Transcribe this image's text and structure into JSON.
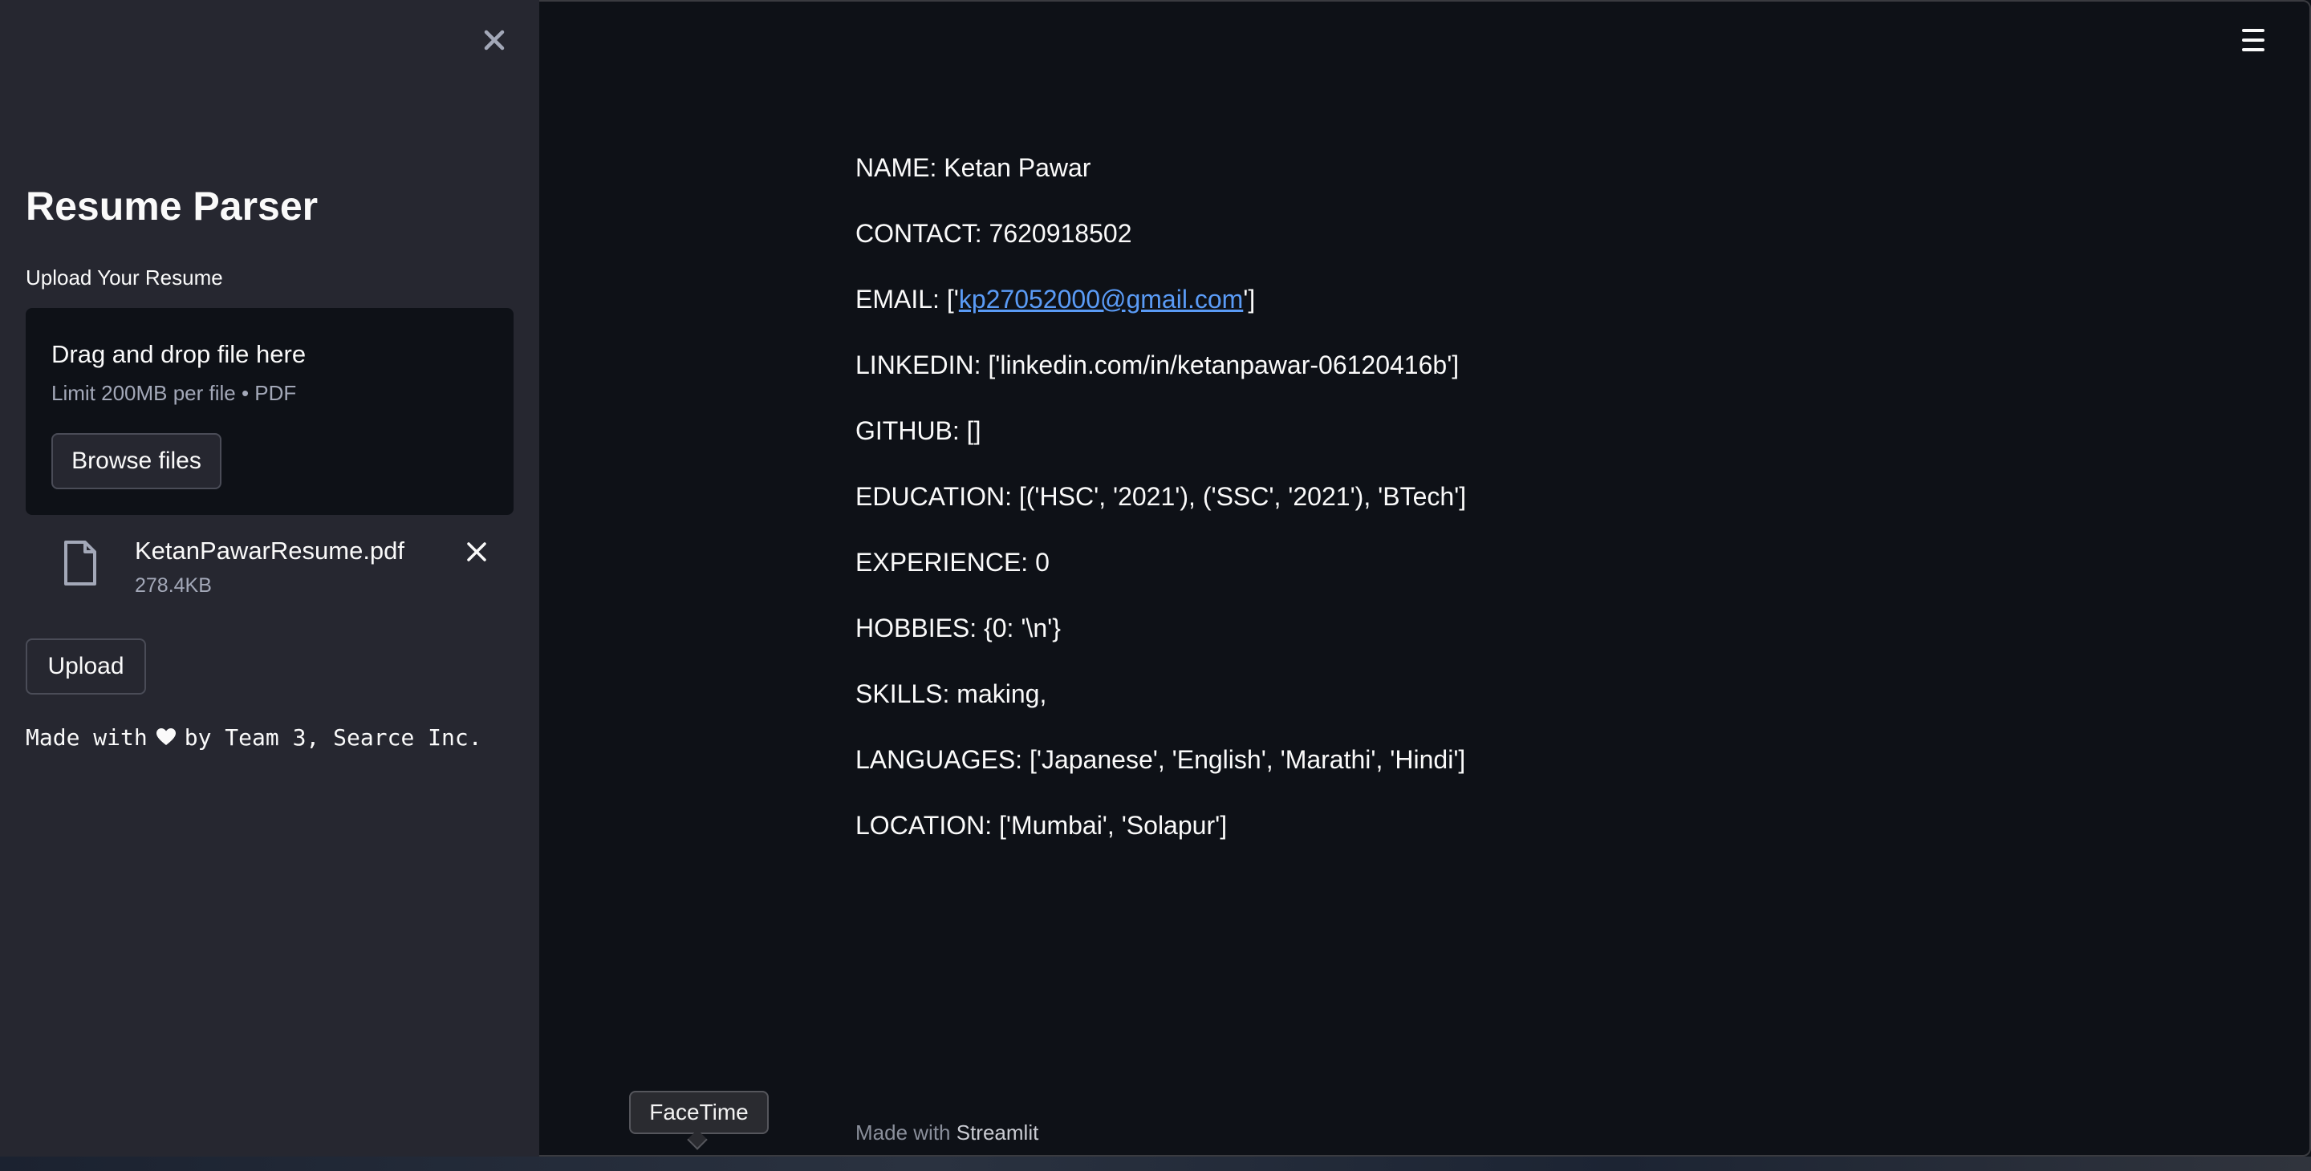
{
  "sidebar": {
    "title": "Resume Parser",
    "upload_label": "Upload Your Resume",
    "dropzone": {
      "title": "Drag and drop file here",
      "limit": "Limit 200MB per file • PDF",
      "browse_label": "Browse files"
    },
    "file": {
      "name": "KetanPawarResume.pdf",
      "size": "278.4KB",
      "icon": "file-icon"
    },
    "upload_button": "Upload",
    "made_with_prefix": "Made with",
    "made_with_suffix": "by Team 3, Searce Inc.",
    "close_icon": "close-icon"
  },
  "main": {
    "fields": [
      {
        "label": "NAME:",
        "value": "Ketan Pawar"
      },
      {
        "label": "CONTACT:",
        "value": "7620918502"
      },
      {
        "label": "EMAIL:",
        "value_pre": "['",
        "link": "kp27052000@gmail.com",
        "value_post": "']"
      },
      {
        "label": "LINKEDIN:",
        "value": "['linkedin.com/in/ketanpawar-06120416b']"
      },
      {
        "label": "GITHUB:",
        "value": "[]"
      },
      {
        "label": "EDUCATION:",
        "value": "[('HSC', '2021'), ('SSC', '2021'), 'BTech']"
      },
      {
        "label": "EXPERIENCE:",
        "value": "0"
      },
      {
        "label": "HOBBIES:",
        "value": "{0: '\\n'}"
      },
      {
        "label": "SKILLS:",
        "value": "making,"
      },
      {
        "label": "LANGUAGES:",
        "value": "['Japanese', 'English', 'Marathi', 'Hindi']"
      },
      {
        "label": "LOCATION:",
        "value": "['Mumbai', 'Solapur']"
      }
    ],
    "footer_prefix": "Made with",
    "footer_brand": "Streamlit",
    "menu_icon": "hamburger-menu-icon"
  },
  "tooltip": {
    "label": "FaceTime"
  },
  "colors": {
    "main_bg": "#0e1117",
    "sidebar_bg": "#262730",
    "link": "#5a9bf6",
    "text": "#fafafa"
  }
}
